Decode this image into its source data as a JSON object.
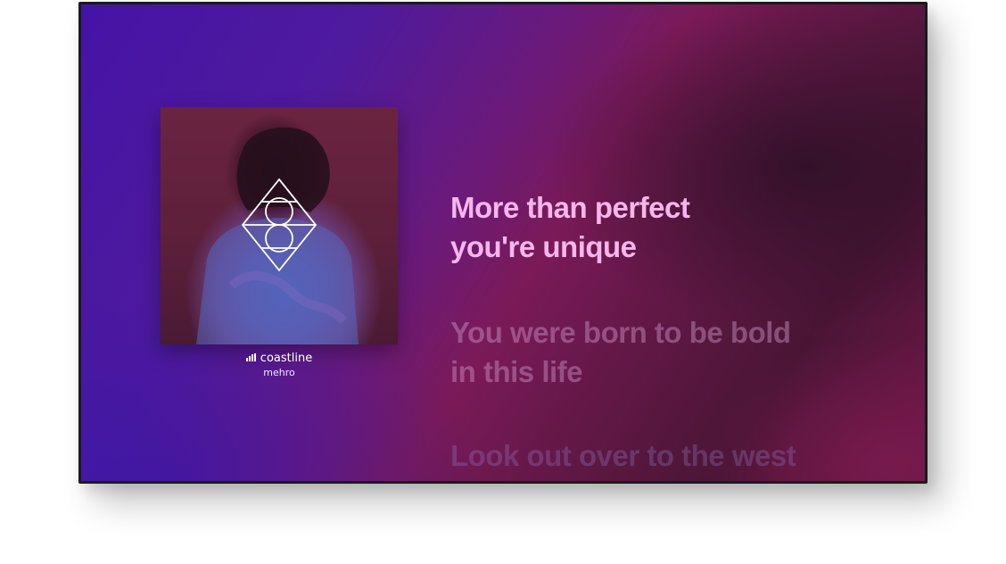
{
  "now_playing": {
    "title": "coastline",
    "artist": "mehro",
    "icons": {
      "playing_indicator": "equalizer-bars-icon",
      "album_logo": "diamond-circles-logo-icon"
    }
  },
  "lyrics": {
    "current": {
      "line1": "More than perfect",
      "line2": "you're unique"
    },
    "next": {
      "line1": "You were born to be bold",
      "line2": "in this life"
    },
    "upcoming": {
      "line1": "Look out over to the west"
    }
  },
  "colors": {
    "lyric_active": "#f6b6ec",
    "background_left": "#4414a6",
    "background_right": "#7a1a57"
  }
}
